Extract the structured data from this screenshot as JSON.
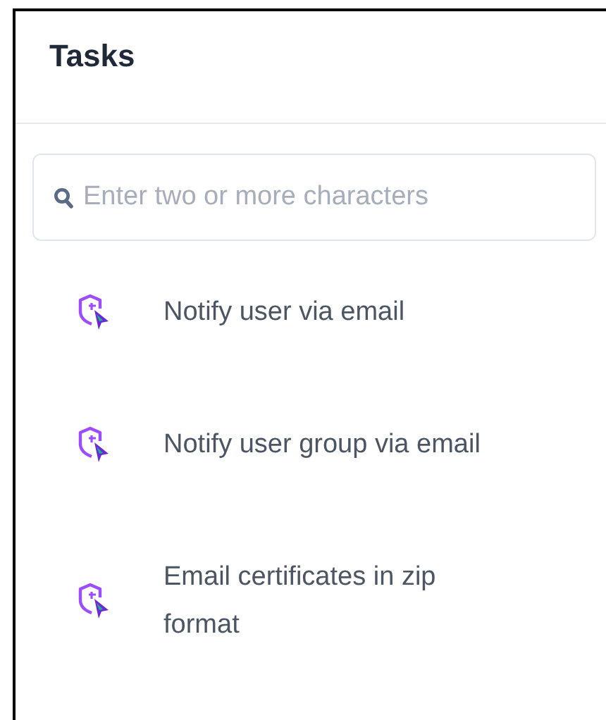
{
  "title": "Tasks",
  "search": {
    "placeholder": "Enter two or more characters"
  },
  "tasks": [
    {
      "label": "Notify user via email"
    },
    {
      "label": "Notify user group via email"
    },
    {
      "label": "Email certificates in zip format"
    }
  ]
}
